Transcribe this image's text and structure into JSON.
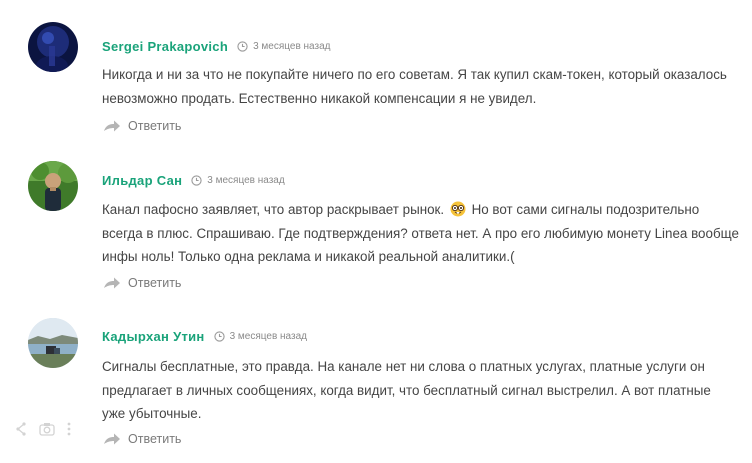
{
  "comments": [
    {
      "author": "Sergei Prakapovich",
      "time": "3 месяцев назад",
      "text_lines": [
        "Никогда и ни за что не покупайте ничего по его советам. Я так купил скам-токен, который оказалось",
        "невозможно продать. Естественно никакой компенсации я не увидел."
      ],
      "reply_label": "Ответить",
      "avatar": "dark-blue-photo"
    },
    {
      "author": "Ильдар Сан",
      "time": "3 месяцев назад",
      "text_line1_before_emoji": "Канал пафосно заявляет, что автор раскрывает рынок.",
      "emoji": "nerd-face-emoji",
      "text_line1_after_emoji": "Но вот сами сигналы подозрительно",
      "text_lines_rest": [
        "всегда в плюс. Спрашиваю. Где подтверждения? ответа нет. А про его любимую монету Linea вообще",
        "инфы ноль! Только одна реклама и никакой реальной аналитики.("
      ],
      "reply_label": "Ответить",
      "avatar": "green-outdoor-photo"
    },
    {
      "author": "Кадырхан Утин",
      "time": "3 месяцев назад",
      "text_lines": [
        "Сигналы бесплатные, это правда. На канале нет ни слова о платных услугах, платные услуги он",
        "предлагает в личных сообщениях, когда видит, что бесплатный сигнал выстрелил. А вот платные",
        "уже убыточные."
      ],
      "reply_label": "Ответить",
      "avatar": "lake-landscape-photo"
    }
  ],
  "icons": {
    "clock": "clock-icon",
    "reply": "reply-arrow-icon",
    "floating": [
      "share-icon",
      "camera-icon",
      "more-vertical-icon"
    ]
  },
  "colors": {
    "author": "#1aa37a",
    "text": "#454545",
    "meta": "#8a8a8a",
    "reply": "#7a7a7a"
  }
}
